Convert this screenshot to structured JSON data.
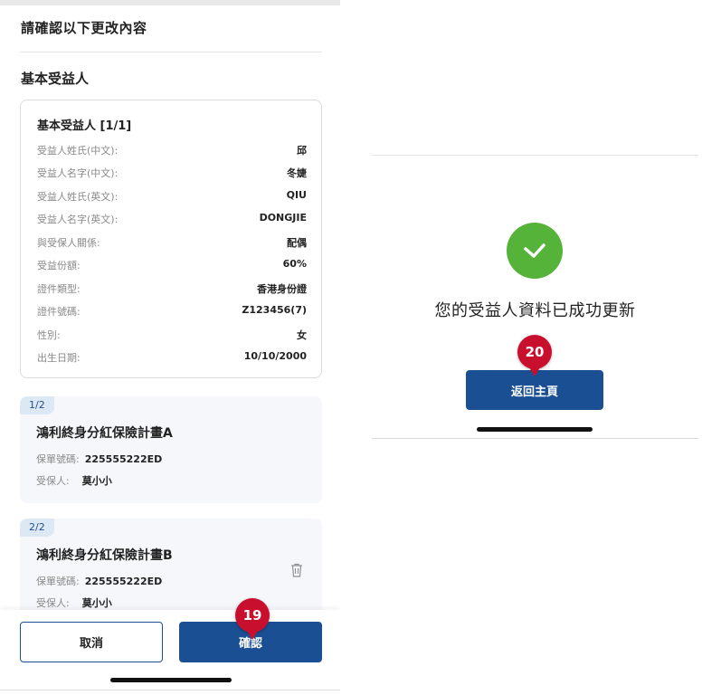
{
  "confirm_screen": {
    "title": "請確認以下更改內容",
    "section_title": "基本受益人",
    "beneficiary_card": {
      "title": "基本受益人 [1/1]",
      "rows": [
        {
          "label": "受益人姓氏(中文):",
          "value": "邱"
        },
        {
          "label": "受益人名字(中文):",
          "value": "冬婕"
        },
        {
          "label": "受益人姓氏(英文):",
          "value": "QIU"
        },
        {
          "label": "受益人名字(英文):",
          "value": "DONGJIE"
        },
        {
          "label": "與受保人關係:",
          "value": "配偶"
        },
        {
          "label": "受益份額:",
          "value": "60%"
        },
        {
          "label": "證件類型:",
          "value": "香港身份證"
        },
        {
          "label": "證件號碼:",
          "value": "Z123456(7)"
        },
        {
          "label": "性別:",
          "value": "女"
        },
        {
          "label": "出生日期:",
          "value": "10/10/2000"
        }
      ]
    },
    "policies": [
      {
        "tag": "1/2",
        "name": "鴻利終身分紅保險計畫A",
        "policy_no_label": "保單號碼:",
        "policy_no": "225555222ED",
        "insured_label": "受保人:",
        "insured": "莫小小"
      },
      {
        "tag": "2/2",
        "name": "鴻利終身分紅保險計畫B",
        "policy_no_label": "保單號碼:",
        "policy_no": "225555222ED",
        "insured_label": "受保人:",
        "insured": "莫小小"
      }
    ],
    "cancel_label": "取消",
    "confirm_label": "確認",
    "step_badge": "19"
  },
  "success_screen": {
    "message": "您的受益人資料已成功更新",
    "home_label": "返回主頁",
    "step_badge": "20"
  },
  "colors": {
    "primary": "#1b4f93",
    "success": "#55b33a",
    "badge": "#c8102e"
  },
  "icons": {
    "success": "check-circle-icon",
    "delete": "trash-icon"
  }
}
